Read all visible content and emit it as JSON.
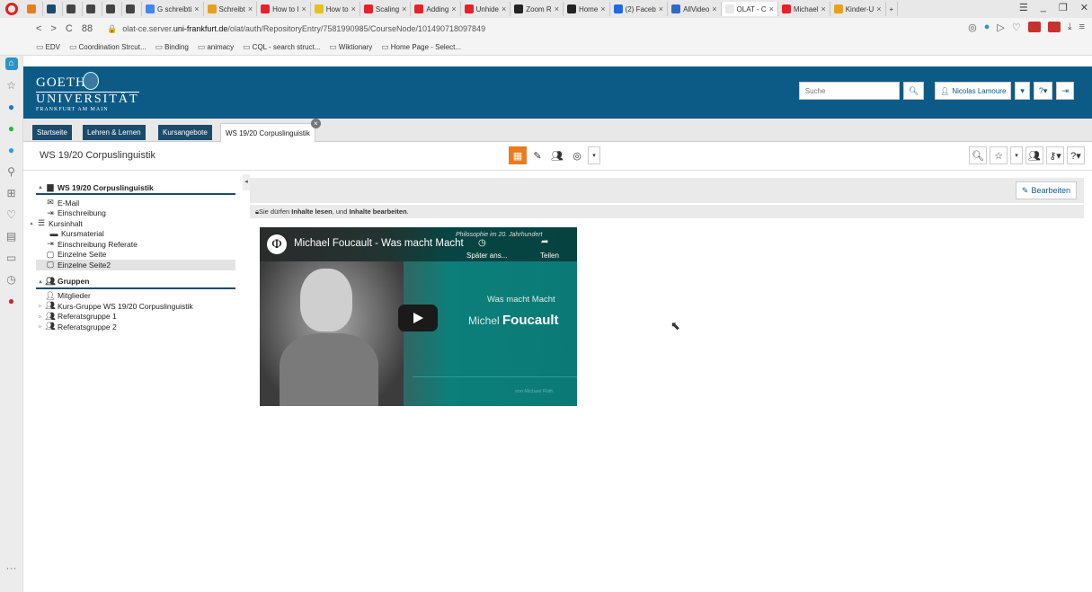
{
  "browser": {
    "tabs": [
      {
        "label": "",
        "color": "#e87d1e"
      },
      {
        "label": "",
        "color": "#1b4b6b"
      },
      {
        "label": "",
        "color": "#444"
      },
      {
        "label": "",
        "color": "#444"
      },
      {
        "label": "",
        "color": "#444"
      },
      {
        "label": "",
        "color": "#444"
      },
      {
        "label": "G schreibti",
        "color": "#4285f4"
      },
      {
        "label": "Schreibt",
        "color": "#e8a01e"
      },
      {
        "label": "How to I",
        "color": "#e8202b"
      },
      {
        "label": "How to",
        "color": "#e8c01e"
      },
      {
        "label": "Scaling",
        "color": "#e8202b"
      },
      {
        "label": "Adding",
        "color": "#e8202b"
      },
      {
        "label": "Unhide",
        "color": "#e8202b"
      },
      {
        "label": "Zoom R",
        "color": "#222"
      },
      {
        "label": "Home",
        "color": "#222"
      },
      {
        "label": "(2) Faceb",
        "color": "#1b6ae8"
      },
      {
        "label": "AllVideo",
        "color": "#2e6ac8"
      },
      {
        "label": "OLAT - C",
        "color": "#e8e8e8"
      },
      {
        "label": "Michael",
        "color": "#e8202b"
      },
      {
        "label": "Kinder-U",
        "color": "#e8a01e"
      }
    ],
    "active_tab": "OLAT - C",
    "url_prefix": "olat-ce.server.",
    "url_domain": "uni-frankfurt.de",
    "url_path": "/olat/auth/RepositoryEntry/7581990985/CourseNode/101490718097849",
    "bookmarks": [
      "EDV",
      "Coordination Strcut...",
      "Binding",
      "animacy",
      "CQL - search struct...",
      "Wiktionary",
      "Home Page - Select..."
    ]
  },
  "header": {
    "logo_line1": "GOETHE",
    "logo_line2": "UNIVERSITÄT",
    "logo_line3": "FRANKFURT AM MAIN",
    "search_placeholder": "Suche",
    "user_name": "Nicolas Lamoure"
  },
  "nav_tabs": [
    "Startseite",
    "Lehren & Lernen",
    "Kursangebote",
    "WS 19/20 Corpuslinguistik"
  ],
  "course_title": "WS 19/20 Corpuslinguistik",
  "menu": {
    "root": "WS 19/20 Corpuslinguistik",
    "items": {
      "email": "E-Mail",
      "einschreibung": "Einschreibung",
      "kursinhalt": "Kursinhalt",
      "kursmaterial": "Kursmaterial",
      "einschreibung_referate": "Einschreibung Referate",
      "einzelne_seite": "Einzelne Seite",
      "einzelne_seite2": "Einzelne Seite2"
    },
    "groups_title": "Gruppen",
    "groups": {
      "mitglieder": "Mitglieder",
      "kursgruppe": "Kurs-Gruppe WS 19/20 Corpuslinguistik",
      "referatsgruppe1": "Referatsgruppe 1",
      "referatsgruppe2": "Referatsgruppe 2"
    }
  },
  "content": {
    "edit_button": "Bearbeiten",
    "info_prefix": "Sie dürfen ",
    "info_b1": "Inhalte lesen",
    "info_mid": ", und ",
    "info_b2": "Inhalte bearbeiten",
    "info_suffix": "."
  },
  "video": {
    "title": "Michael Foucault - Was macht Macht",
    "overlay_series": "Philosophie im 20. Jahrhundert",
    "watch_later": "Später ans...",
    "share": "Teilen",
    "subtitle": "Was macht Macht",
    "name_first": "Michel ",
    "name_last": "Foucault",
    "credit": "von Michael Röth"
  },
  "colors": {
    "brand": "#0c5a86",
    "nav_tab": "#1b4b6b",
    "active_tool": "#e87d1e",
    "video_teal": "#0b7a76"
  }
}
